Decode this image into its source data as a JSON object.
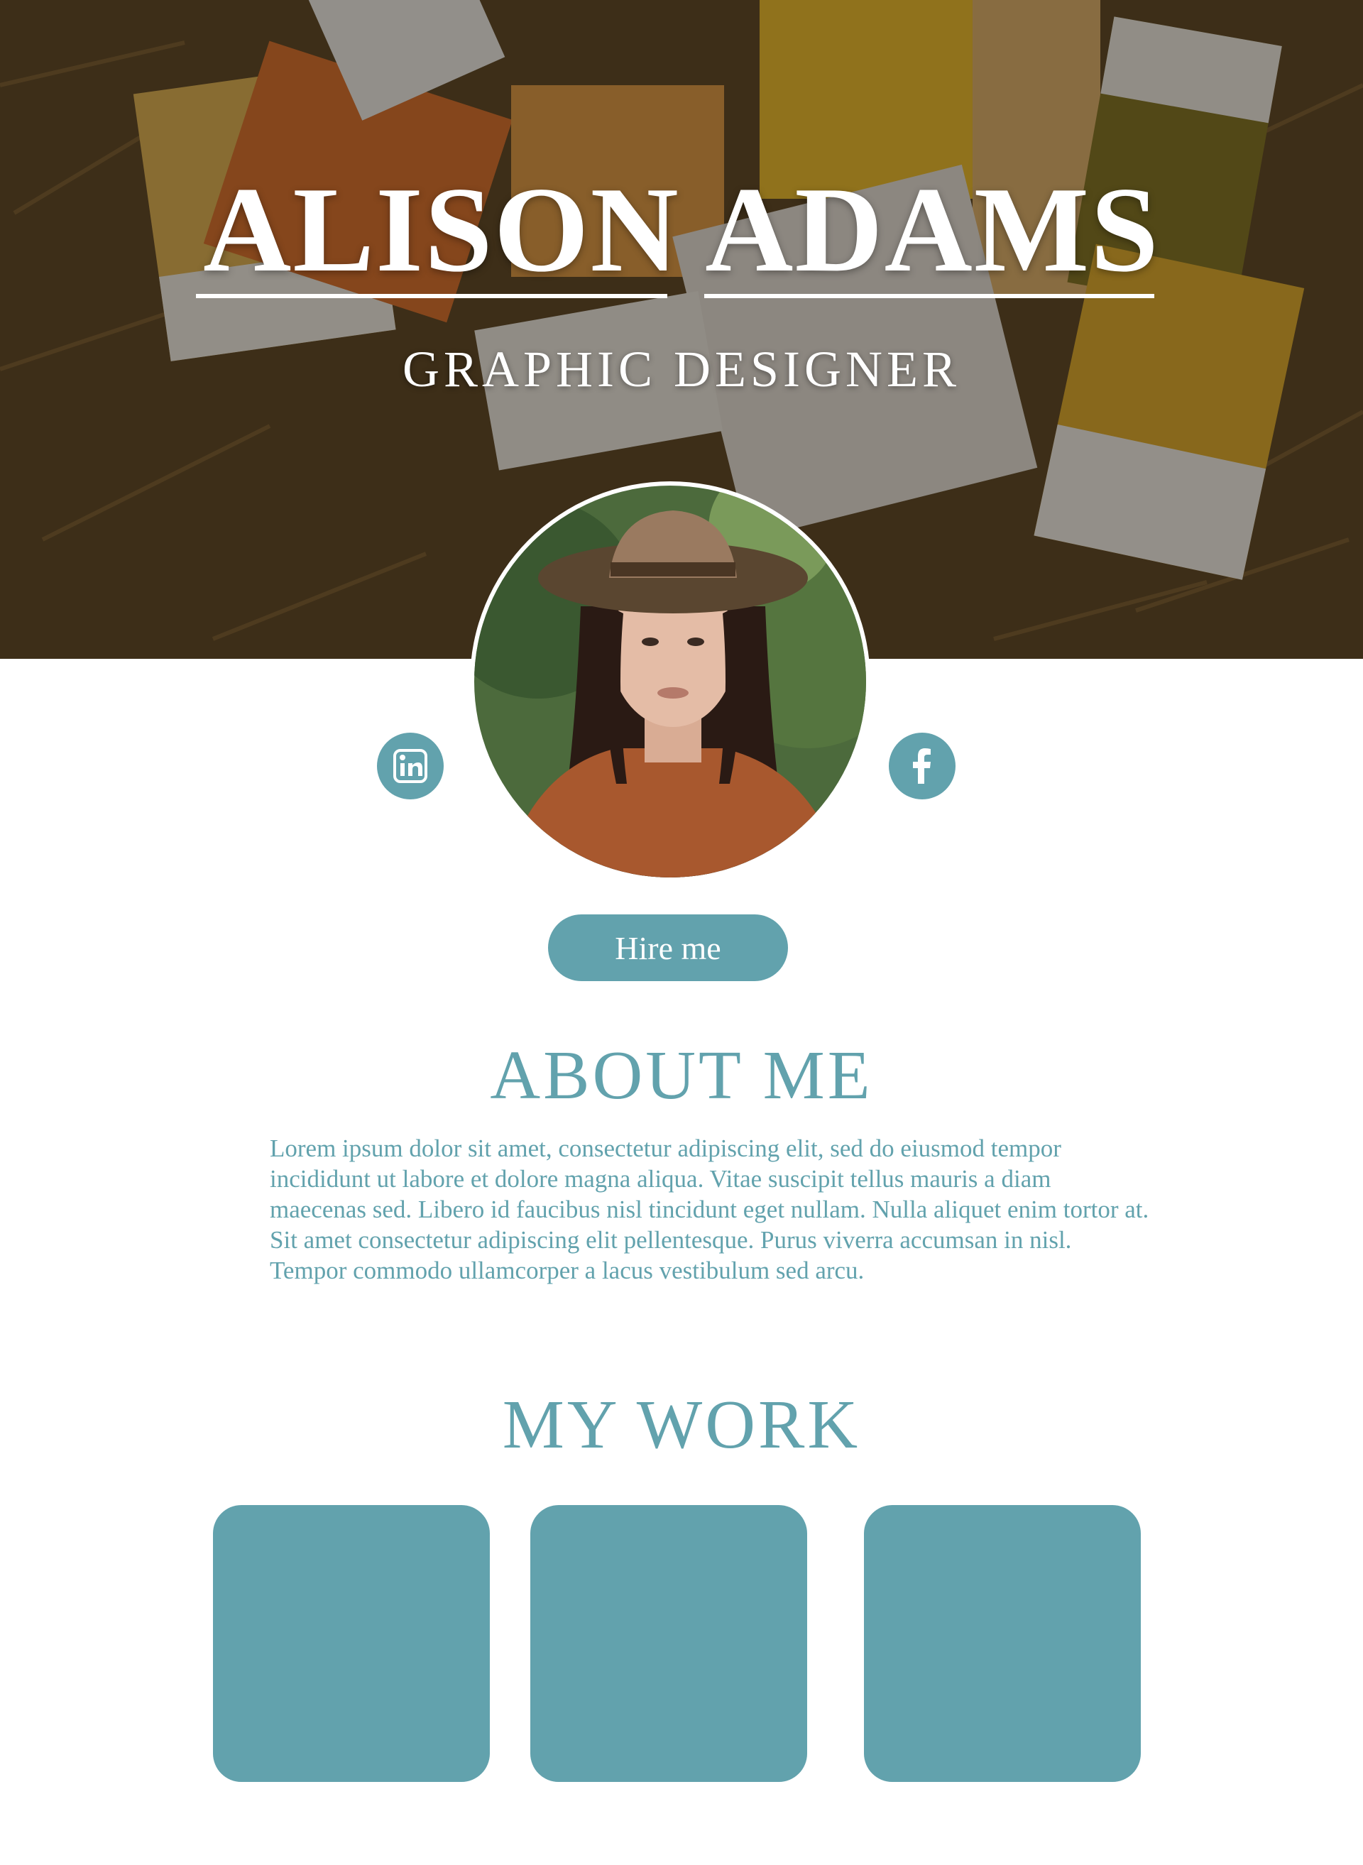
{
  "hero": {
    "name": "ALISON ADAMS",
    "subtitle": "GRAPHIC DESIGNER"
  },
  "social": {
    "linkedin": "linkedin-icon",
    "facebook": "facebook-icon"
  },
  "cta": {
    "hire_label": "Hire me"
  },
  "about": {
    "heading": "ABOUT ME",
    "body": "Lorem ipsum dolor sit amet, consectetur adipiscing elit, sed do eiusmod tempor incididunt ut labore et dolore magna aliqua. Vitae suscipit tellus mauris a diam maecenas sed. Libero id faucibus nisl tincidunt eget nullam. Nulla aliquet enim tortor at. Sit amet consectetur adipiscing elit pellentesque. Purus viverra accumsan in nisl. Tempor commodo ullamcorper a lacus vestibulum sed arcu."
  },
  "work": {
    "heading": "MY WORK",
    "cards": [
      "work-item-1",
      "work-item-2",
      "work-item-3"
    ]
  },
  "colors": {
    "accent": "#62a2ad",
    "background": "#ffffff"
  }
}
